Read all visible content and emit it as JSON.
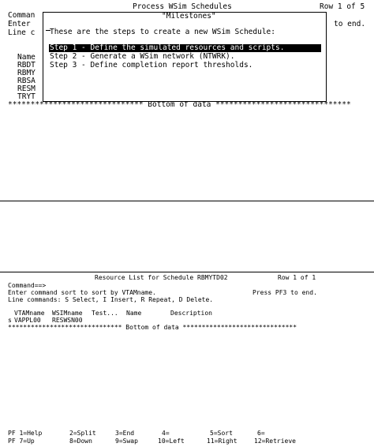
{
  "screen1": {
    "title": "Process WSim Schedules",
    "row_indicator": "Row 1 of 5",
    "command_label": "Comman",
    "enter_label": "Enter",
    "end_fragment": "to end.",
    "line_cmd_label": "Line c",
    "col_name": "Name",
    "rows": [
      "RBDT",
      "RBMY",
      "RBSA",
      "RESM",
      "TRYT"
    ],
    "bottom": "****************************** Bottom of data ******************************"
  },
  "popup": {
    "title": "\"Milestones\"",
    "intro": "These are the steps to create a new WSim Schedule:",
    "steps": [
      "Step 1 - Define the simulated resources and scripts.",
      "Step 2 - Generate a WSim network (NTWRK).",
      "Step 3 - Define completion report thresholds."
    ]
  },
  "screen2": {
    "title": "Resource List for Schedule RBMYTD02",
    "row_indicator": "Row 1 of 1",
    "command_prompt": "Command==>",
    "instruction": "Enter command sort to sort by VTAMname.",
    "pf3": "Press PF3 to end.",
    "line_commands": "Line commands: S Select, I Insert, R Repeat, D Delete.",
    "headers": {
      "vtam": "VTAMname",
      "wsim": "WSIMname",
      "test": "Test...",
      "name": "Name",
      "desc": "Description"
    },
    "row": {
      "sel": "s",
      "vtam": "VAPPL00",
      "wsim": "RESWSN00"
    },
    "bottom": "****************************** Bottom of data ******************************"
  },
  "pf_keys": {
    "row1": [
      "PF 1=Help",
      "2=Split",
      "3=End",
      "4=",
      "5=Sort",
      "6="
    ],
    "row2": [
      "PF 7=Up",
      "8=Down",
      "9=Swap",
      "10=Left",
      "11=Right",
      "12=Retrieve"
    ]
  }
}
